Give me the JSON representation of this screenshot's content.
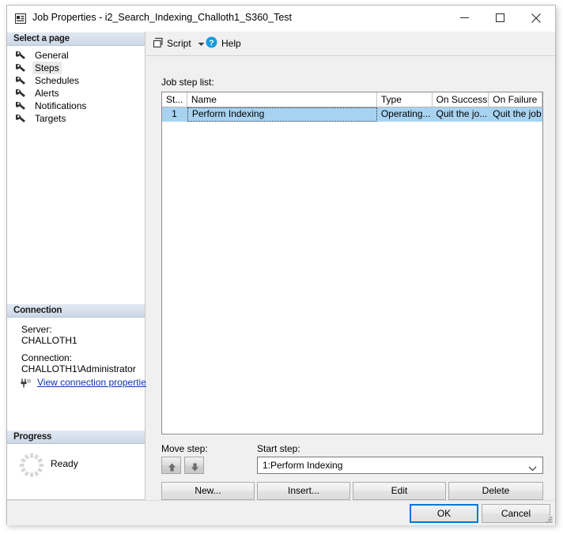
{
  "window": {
    "title": "Job Properties - i2_Search_Indexing_Challoth1_S360_Test",
    "icon": "properties-icon",
    "minimize_label": "Minimize",
    "maximize_label": "Maximize",
    "close_label": "Close"
  },
  "sidebar": {
    "select_page_header": "Select a page",
    "items": [
      {
        "label": "General",
        "icon": "wrench-icon",
        "selected": false
      },
      {
        "label": "Steps",
        "icon": "wrench-icon",
        "selected": true
      },
      {
        "label": "Schedules",
        "icon": "wrench-icon",
        "selected": false
      },
      {
        "label": "Alerts",
        "icon": "wrench-icon",
        "selected": false
      },
      {
        "label": "Notifications",
        "icon": "wrench-icon",
        "selected": false
      },
      {
        "label": "Targets",
        "icon": "wrench-icon",
        "selected": false
      }
    ],
    "connection": {
      "header": "Connection",
      "server_label": "Server:",
      "server_value": "CHALLOTH1",
      "connection_label": "Connection:",
      "connection_value": "CHALLOTH1\\Administrator",
      "link_text": "View connection properties",
      "link_icon": "connection-properties-icon",
      "link_color": "#0b35a8"
    },
    "progress": {
      "header": "Progress",
      "status": "Ready",
      "spinner_icon": "progress-spinner-icon"
    }
  },
  "toolbar": {
    "script_label": "Script",
    "script_icon": "script-icon",
    "script_dropdown_icon": "chevron-down-icon",
    "help_label": "Help",
    "help_icon": "help-question-icon",
    "help_icon_color": "#1a9ae0"
  },
  "main": {
    "list_label": "Job step list:",
    "grid": {
      "columns": [
        "St...",
        "Name",
        "Type",
        "On Success",
        "On Failure"
      ],
      "rows": [
        {
          "step": "1",
          "name": "Perform Indexing",
          "type": "Operating...",
          "on_success": "Quit the jo...",
          "on_failure": "Quit the job...",
          "selected": true
        }
      ],
      "selection_color": "#a8d3f0"
    },
    "move_step_label": "Move step:",
    "move_up_icon": "arrow-up-icon",
    "move_down_icon": "arrow-down-icon",
    "start_step_label": "Start step:",
    "start_step_value": "1:Perform Indexing",
    "start_step_arrow_icon": "chevron-down-icon",
    "buttons": {
      "new": "New...",
      "insert": "Insert...",
      "edit": "Edit",
      "delete": "Delete"
    }
  },
  "footer": {
    "ok": "OK",
    "cancel": "Cancel",
    "ok_focus_color": "#0078d7",
    "resize_grip_icon": "resize-grip-icon"
  }
}
